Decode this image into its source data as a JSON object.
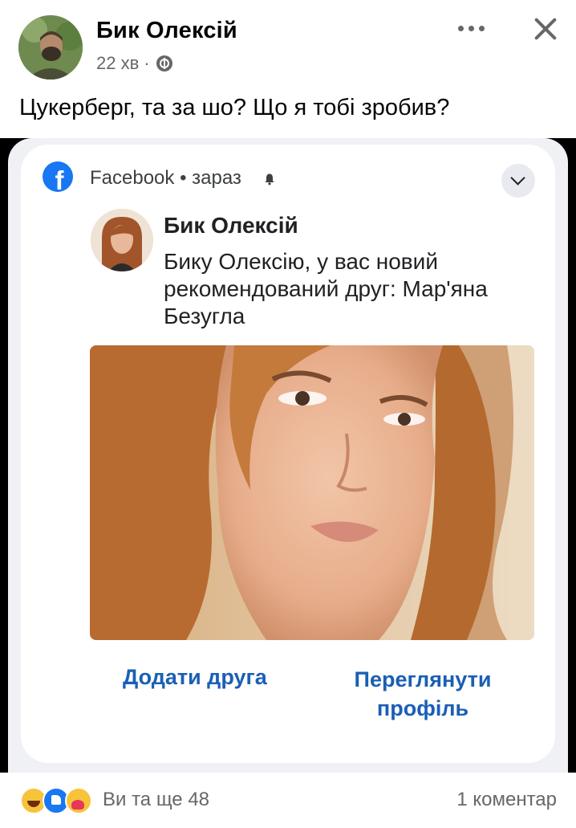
{
  "post": {
    "author": "Бик Олексій",
    "time": "22 хв",
    "separator": "·",
    "text": "Цукерберг, та за шо? Що я тобі зробив?"
  },
  "notification": {
    "app_name": "Facebook",
    "time": "• зараз",
    "title": "Бик Олексій",
    "body": "Бику Олексію, у вас новий рекомендований друг: Мар'яна Безугла",
    "add_friend_label": "Додати друга",
    "view_profile_label": "Переглянути профіль"
  },
  "footer": {
    "reactions_text": "Ви та ще 48",
    "comments_text": "1 коментар",
    "reaction_icons": [
      "haha-icon",
      "like-icon",
      "care-icon"
    ]
  },
  "icons": {
    "fb_logo_letter": "f",
    "more": "more-horizontal-icon",
    "close": "close-icon",
    "globe": "globe-icon",
    "chevron": "chevron-down-icon",
    "bell": "bell-icon"
  },
  "colors": {
    "link_blue": "#1a5fb4",
    "facebook_blue": "#1877f2",
    "secondary_text": "#65676b"
  }
}
